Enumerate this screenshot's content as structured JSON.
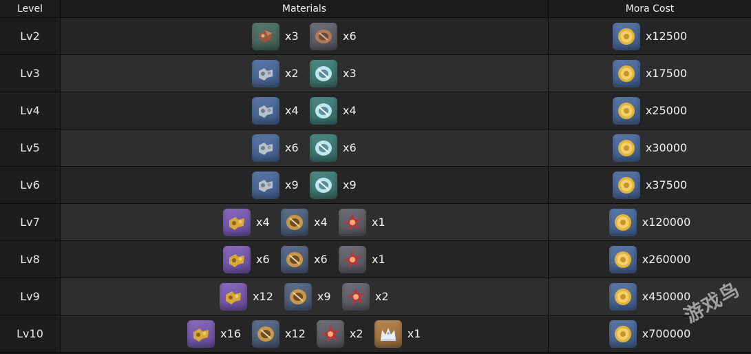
{
  "header": {
    "level": "Level",
    "materials": "Materials",
    "mora": "Mora Cost"
  },
  "rows": [
    {
      "level": "Lv2",
      "mats": [
        {
          "icon": "debris-icon",
          "qty": "x3"
        },
        {
          "icon": "copper-ring-icon",
          "qty": "x6"
        }
      ],
      "mora": "x12500"
    },
    {
      "level": "Lv3",
      "mats": [
        {
          "icon": "gear-part-icon",
          "qty": "x2"
        },
        {
          "icon": "crystal-ring-icon",
          "qty": "x3"
        }
      ],
      "mora": "x17500"
    },
    {
      "level": "Lv4",
      "mats": [
        {
          "icon": "gear-part-icon",
          "qty": "x4"
        },
        {
          "icon": "crystal-ring-icon",
          "qty": "x4"
        }
      ],
      "mora": "x25000"
    },
    {
      "level": "Lv5",
      "mats": [
        {
          "icon": "gear-part-icon",
          "qty": "x6"
        },
        {
          "icon": "crystal-ring-icon",
          "qty": "x6"
        }
      ],
      "mora": "x30000"
    },
    {
      "level": "Lv6",
      "mats": [
        {
          "icon": "gear-part-icon",
          "qty": "x9"
        },
        {
          "icon": "crystal-ring-icon",
          "qty": "x9"
        }
      ],
      "mora": "x37500"
    },
    {
      "level": "Lv7",
      "mats": [
        {
          "icon": "gold-part-icon",
          "qty": "x4"
        },
        {
          "icon": "gold-ring-icon",
          "qty": "x4"
        },
        {
          "icon": "red-shard-icon",
          "qty": "x1"
        }
      ],
      "mora": "x120000"
    },
    {
      "level": "Lv8",
      "mats": [
        {
          "icon": "gold-part-icon",
          "qty": "x6"
        },
        {
          "icon": "gold-ring-icon",
          "qty": "x6"
        },
        {
          "icon": "red-shard-icon",
          "qty": "x1"
        }
      ],
      "mora": "x260000"
    },
    {
      "level": "Lv9",
      "mats": [
        {
          "icon": "gold-part-icon",
          "qty": "x12"
        },
        {
          "icon": "gold-ring-icon",
          "qty": "x9"
        },
        {
          "icon": "red-shard-icon",
          "qty": "x2"
        }
      ],
      "mora": "x450000"
    },
    {
      "level": "Lv10",
      "mats": [
        {
          "icon": "gold-part-icon",
          "qty": "x16"
        },
        {
          "icon": "gold-ring-icon",
          "qty": "x12"
        },
        {
          "icon": "red-shard-icon",
          "qty": "x2"
        },
        {
          "icon": "crown-icon",
          "qty": "x1"
        }
      ],
      "mora": "x700000"
    }
  ],
  "watermark": "游戏鸟"
}
